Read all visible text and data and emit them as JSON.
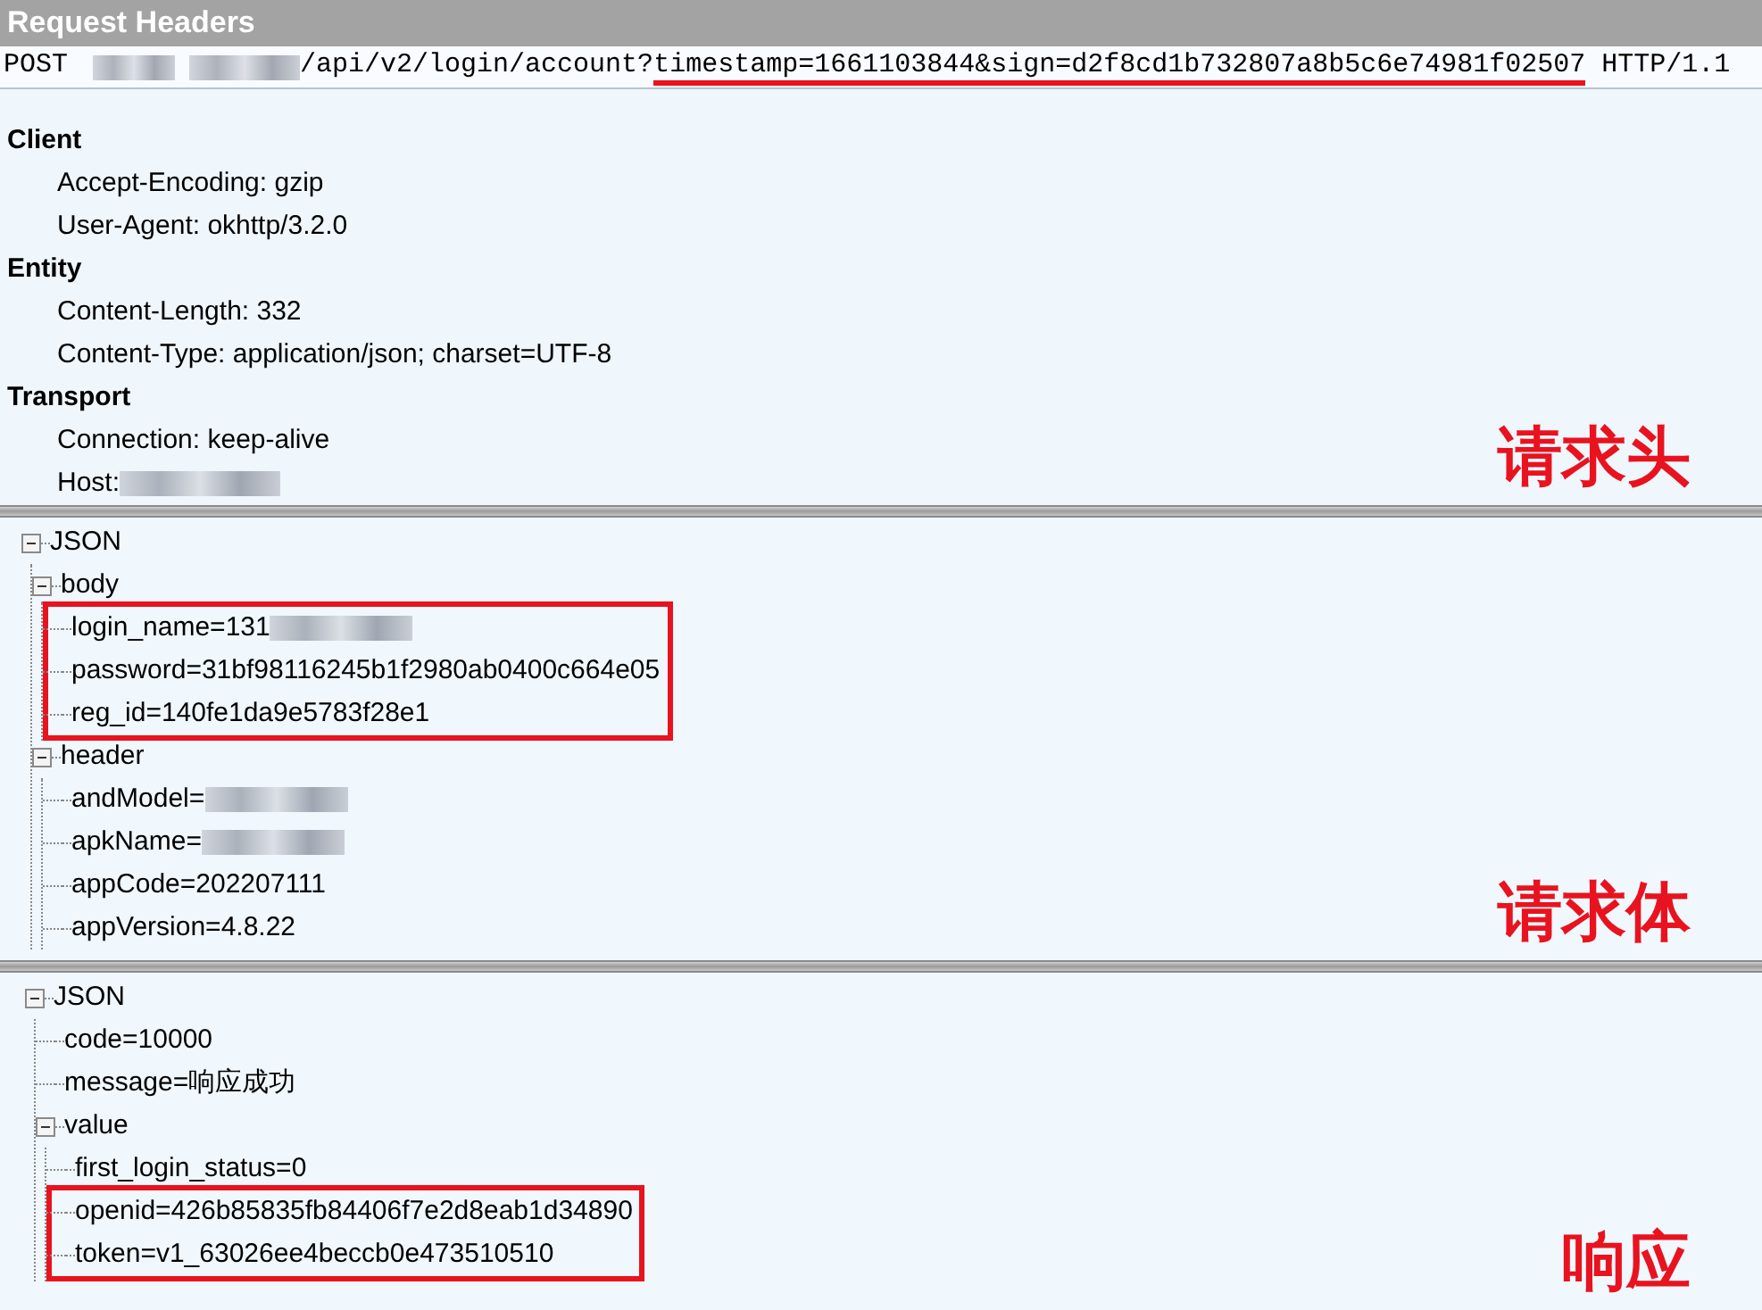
{
  "title": "Request Headers",
  "request_line": {
    "method": "POST",
    "path": "/api/v2/login/account?",
    "query": "timestamp=1661103844&sign=d2f8cd1b732807a8b5c6e74981f02507",
    "query_underlined": true,
    "protocol": "HTTP/1.1"
  },
  "header_groups": [
    {
      "name": "Client",
      "items": [
        {
          "text": "Accept-Encoding: gzip",
          "redacted": false
        },
        {
          "text": "User-Agent: okhttp/3.2.0",
          "redacted": false
        }
      ]
    },
    {
      "name": "Entity",
      "items": [
        {
          "text": "Content-Length: 332",
          "redacted": false
        },
        {
          "text": "Content-Type: application/json; charset=UTF-8",
          "redacted": false
        }
      ]
    },
    {
      "name": "Transport",
      "items": [
        {
          "text": "Connection: keep-alive",
          "redacted": false
        },
        {
          "text": "Host:",
          "redacted": true
        }
      ]
    }
  ],
  "headers_annotation": "请求头",
  "request_tree": [
    {
      "label": "JSON",
      "expanded": true,
      "highlighted": false,
      "redacted": false,
      "children": [
        {
          "label": "body",
          "expanded": true,
          "highlighted": false,
          "redacted": false,
          "children": [
            {
              "label": "login_name=131",
              "highlighted": true,
              "redacted": true
            },
            {
              "label": "password=31bf98116245b1f2980ab0400c664e05",
              "highlighted": true,
              "redacted": false
            },
            {
              "label": "reg_id=140fe1da9e5783f28e1",
              "highlighted": true,
              "redacted": false
            }
          ]
        },
        {
          "label": "header",
          "expanded": true,
          "highlighted": false,
          "redacted": false,
          "children": [
            {
              "label": "andModel=",
              "highlighted": false,
              "redacted": true
            },
            {
              "label": "apkName=",
              "highlighted": false,
              "redacted": true
            },
            {
              "label": "appCode=202207111",
              "highlighted": false,
              "redacted": false
            },
            {
              "label": "appVersion=4.8.22",
              "highlighted": false,
              "redacted": false
            }
          ]
        }
      ]
    }
  ],
  "request_annotation": "请求体",
  "response_tree": [
    {
      "label": "JSON",
      "expanded": true,
      "highlighted": false,
      "redacted": false,
      "children": [
        {
          "label": "code=10000",
          "highlighted": false,
          "redacted": false
        },
        {
          "label": "message=响应成功",
          "highlighted": false,
          "redacted": false
        },
        {
          "label": "value",
          "expanded": true,
          "highlighted": false,
          "redacted": false,
          "children": [
            {
              "label": "first_login_status=0",
              "highlighted": false,
              "redacted": false
            },
            {
              "label": "openid=426b85835fb84406f7e2d8eab1d34890",
              "highlighted": true,
              "redacted": false
            },
            {
              "label": "token=v1_63026ee4beccb0e473510510",
              "highlighted": true,
              "redacted": false
            }
          ]
        }
      ]
    }
  ],
  "response_annotation": "响应"
}
